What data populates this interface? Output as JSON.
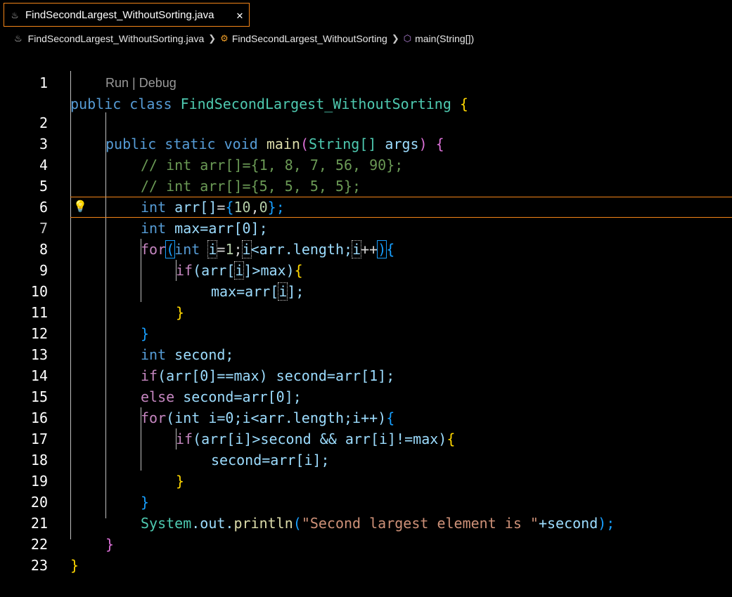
{
  "tab": {
    "icon": "java-icon",
    "label": "FindSecondLargest_WithoutSorting.java",
    "close": "✕"
  },
  "breadcrumb": {
    "file": "FindSecondLargest_WithoutSorting.java",
    "class": "FindSecondLargest_WithoutSorting",
    "method": "main(String[])"
  },
  "codelens": "Run | Debug",
  "line_numbers": [
    "1",
    "2",
    "3",
    "4",
    "5",
    "6",
    "7",
    "8",
    "9",
    "10",
    "11",
    "12",
    "13",
    "14",
    "15",
    "16",
    "17",
    "18",
    "19",
    "20",
    "21",
    "22",
    "23"
  ],
  "code": {
    "l1_public": "public",
    "l1_class": "class",
    "l1_name": "FindSecondLargest_WithoutSorting",
    "l1_brace": "{",
    "l2_public": "public",
    "l2_static": "static",
    "l2_void": "void",
    "l2_main": "main",
    "l2_open": "(",
    "l2_type": "String[]",
    "l2_args": "args",
    "l2_close": ")",
    "l2_brace": "{",
    "l3": "// int arr[]={1, 8, 7, 56, 90};",
    "l4": "// int arr[]={5, 5, 5, 5};",
    "l5_int": "int",
    "l5_arr": "arr[]",
    "l5_eq": "=",
    "l5_ob": "{",
    "l5_n1": "10",
    "l5_comma": ",",
    "l5_n2": "0",
    "l5_cb": "};",
    "l6_int": "int",
    "l6_rest": "max=arr[0];",
    "l7_for": "for",
    "l7_op": "(",
    "l7_int": "int",
    "l7_i1": "i",
    "l7_a": "=",
    "l7_one": "1",
    "l7_b": ";",
    "l7_i2": "i",
    "l7_c": "<arr.length;",
    "l7_i3": "i",
    "l7_d": "++",
    "l7_cp": ")",
    "l7_br": "{",
    "l8_if": "if",
    "l8_a": "(arr[",
    "l8_i": "i",
    "l8_b": "]>max)",
    "l8_br": "{",
    "l9_a": "max=arr[",
    "l9_i": "i",
    "l9_b": "];",
    "l10": "}",
    "l11": "}",
    "l12_int": "int",
    "l12_rest": "second;",
    "l13_if": "if",
    "l13_rest": "(arr[0]==max) second=arr[1];",
    "l14_else": "else",
    "l14_rest": "second=arr[0];",
    "l15_for": "for",
    "l15_rest": "(int i=0;i<arr.length;i++)",
    "l15_br": "{",
    "l16_if": "if",
    "l16_rest": "(arr[i]>second && arr[i]!=max)",
    "l16_br": "{",
    "l17": "second=arr[i];",
    "l18": "}",
    "l19": "}",
    "l20_sys": "System",
    "l20_out": ".out.",
    "l20_fn": "println",
    "l20_op": "(",
    "l20_str": "\"Second largest element is \"",
    "l20_rest": "+second",
    "l20_cp": ");",
    "l21": "}",
    "l22": "}"
  },
  "colors": {
    "accent": "#f38518",
    "keyword": "#569cd6",
    "control": "#c586c0",
    "comment": "#6a9955",
    "string": "#ce9178"
  }
}
